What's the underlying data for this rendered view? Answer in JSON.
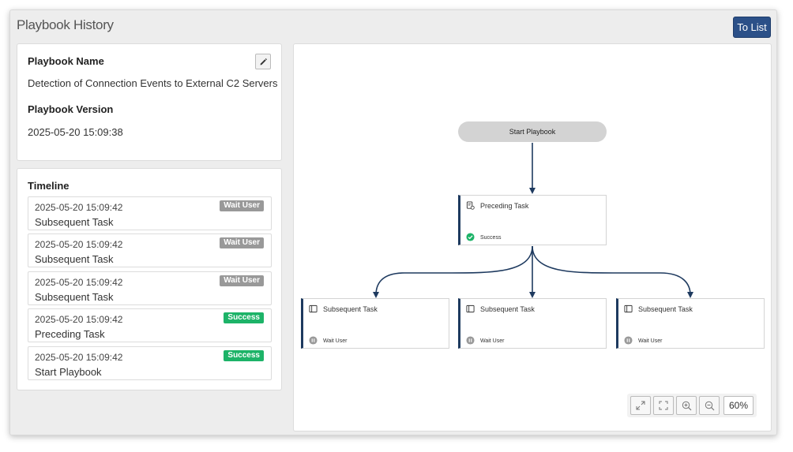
{
  "page": {
    "title": "Playbook History"
  },
  "header": {
    "to_list_label": "To List"
  },
  "info": {
    "name_label": "Playbook Name",
    "name_value": "Detection of Connection Events to External C2 Servers",
    "version_label": "Playbook Version",
    "version_value": "2025-05-20 15:09:38",
    "edit_icon": "pencil-icon"
  },
  "timeline": {
    "title": "Timeline",
    "items": [
      {
        "time": "2025-05-20 15:09:42",
        "name": "Subsequent Task",
        "status": "Wait User"
      },
      {
        "time": "2025-05-20 15:09:42",
        "name": "Subsequent Task",
        "status": "Wait User"
      },
      {
        "time": "2025-05-20 15:09:42",
        "name": "Subsequent Task",
        "status": "Wait User"
      },
      {
        "time": "2025-05-20 15:09:42",
        "name": "Preceding Task",
        "status": "Success"
      },
      {
        "time": "2025-05-20 15:09:42",
        "name": "Start Playbook",
        "status": "Success"
      }
    ]
  },
  "flow": {
    "start_label": "Start Playbook",
    "preceding": {
      "title": "Preceding Task",
      "status": "Success"
    },
    "subsequent": [
      {
        "title": "Subsequent Task",
        "status": "Wait User"
      },
      {
        "title": "Subsequent Task",
        "status": "Wait User"
      },
      {
        "title": "Subsequent Task",
        "status": "Wait User"
      }
    ],
    "zoom_level": "60%"
  },
  "colors": {
    "accent": "#2b5088",
    "edge": "#1e3a5f",
    "success": "#1db368",
    "wait": "#999999"
  }
}
